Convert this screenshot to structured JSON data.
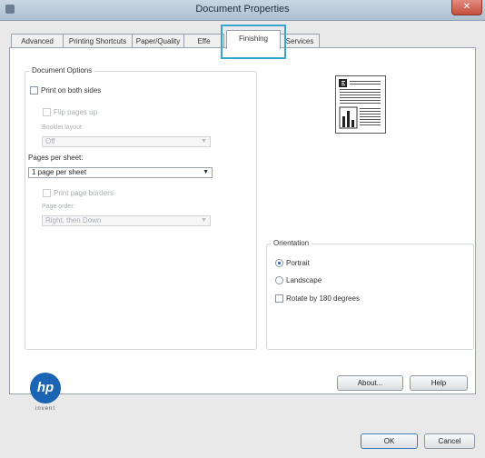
{
  "window": {
    "title": "Document Properties",
    "close_label": "✕"
  },
  "tabs": [
    {
      "label": "Advanced",
      "active": false
    },
    {
      "label": "Printing Shortcuts",
      "active": false
    },
    {
      "label": "Paper/Quality",
      "active": false
    },
    {
      "label": "Effe",
      "active": false
    },
    {
      "label": "Finishing",
      "active": true
    },
    {
      "label": "Services",
      "active": false
    }
  ],
  "document_options": {
    "legend": "Document Options",
    "print_both_sides": {
      "label": "Print on both sides",
      "checked": false
    },
    "flip_pages_up": {
      "label": "Flip pages up",
      "checked": false,
      "enabled": false
    },
    "booklet_layout": {
      "label": "Booklet layout",
      "value": "Off",
      "enabled": false
    },
    "pages_per_sheet": {
      "label": "Pages per sheet:",
      "value": "1 page per sheet"
    },
    "print_page_borders": {
      "label": "Print page borders",
      "checked": false,
      "enabled": false
    },
    "page_order": {
      "label": "Page order:",
      "value": "Right, then Down",
      "enabled": false
    }
  },
  "orientation": {
    "legend": "Orientation",
    "options": [
      {
        "label": "Portrait",
        "selected": true
      },
      {
        "label": "Landscape",
        "selected": false
      }
    ],
    "rotate_180": {
      "label": "Rotate by 180 degrees",
      "checked": false
    }
  },
  "footer": {
    "logo_text": "hp",
    "logo_caption": "invent",
    "about_label": "About...",
    "help_label": "Help",
    "ok_label": "OK",
    "cancel_label": "Cancel"
  }
}
